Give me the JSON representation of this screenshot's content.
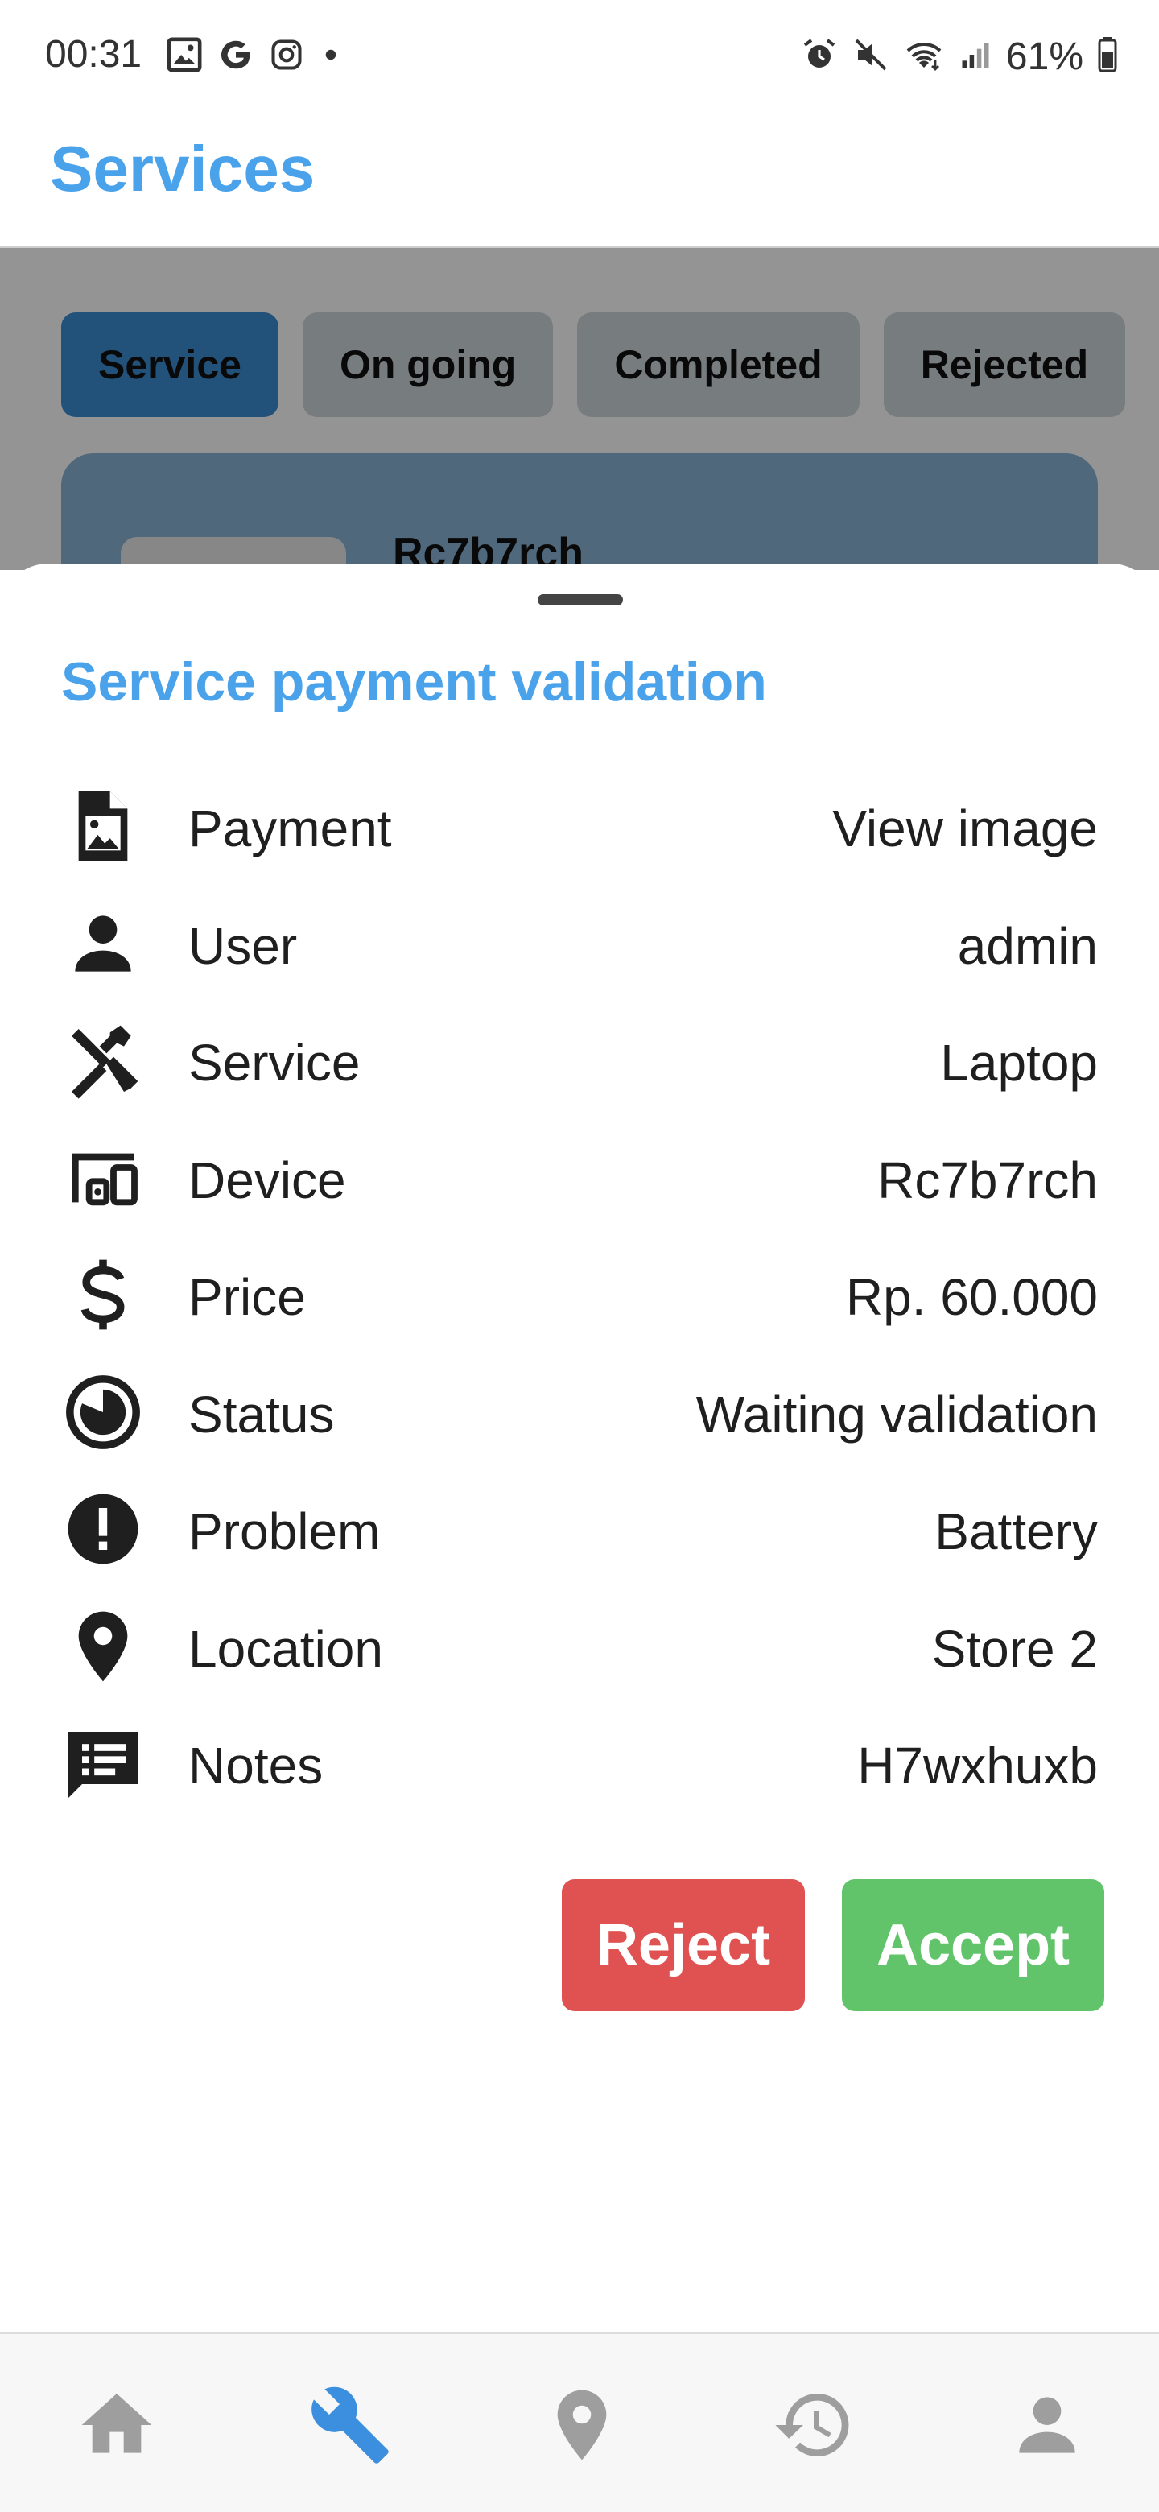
{
  "status_bar": {
    "time": "00:31",
    "battery": "61%",
    "left_icons": [
      "gallery-icon",
      "google-icon",
      "instagram-icon",
      "dot-icon"
    ],
    "right_icons": [
      "alarm-icon",
      "mute-icon",
      "wifi-icon",
      "signal-icon",
      "battery-icon"
    ]
  },
  "app_bar": {
    "title": "Services"
  },
  "tabs": [
    {
      "label": "Service",
      "active": true
    },
    {
      "label": "On going",
      "active": false
    },
    {
      "label": "Completed",
      "active": false
    },
    {
      "label": "Rejected",
      "active": false
    }
  ],
  "card": {
    "title": "Rc7b7rch"
  },
  "sheet": {
    "title": "Service payment validation",
    "rows": [
      {
        "icon": "image-file-icon",
        "label": "Payment",
        "value": "View image"
      },
      {
        "icon": "person-icon",
        "label": "User",
        "value": "admin"
      },
      {
        "icon": "tools-icon",
        "label": "Service",
        "value": "Laptop"
      },
      {
        "icon": "devices-icon",
        "label": "Device",
        "value": "Rc7b7rch"
      },
      {
        "icon": "dollar-icon",
        "label": "Price",
        "value": "Rp. 60.000"
      },
      {
        "icon": "pie-clock-icon",
        "label": "Status",
        "value": "Waiting validation"
      },
      {
        "icon": "exclamation-icon",
        "label": "Problem",
        "value": "Battery"
      },
      {
        "icon": "location-pin-icon",
        "label": "Location",
        "value": "Store 2"
      },
      {
        "icon": "notes-icon",
        "label": "Notes",
        "value": "H7wxhuxb"
      }
    ],
    "reject_label": "Reject",
    "accept_label": "Accept"
  },
  "bottom_nav": [
    {
      "icon": "home-icon",
      "active": false
    },
    {
      "icon": "wrench-icon",
      "active": true
    },
    {
      "icon": "location-icon",
      "active": false
    },
    {
      "icon": "history-icon",
      "active": false
    },
    {
      "icon": "profile-icon",
      "active": false
    }
  ],
  "colors": {
    "accent": "#4aa3ea",
    "reject": "#e05252",
    "accept": "#62c46a",
    "active_tab": "#3c8cd2",
    "card": "#8ab3d5"
  }
}
